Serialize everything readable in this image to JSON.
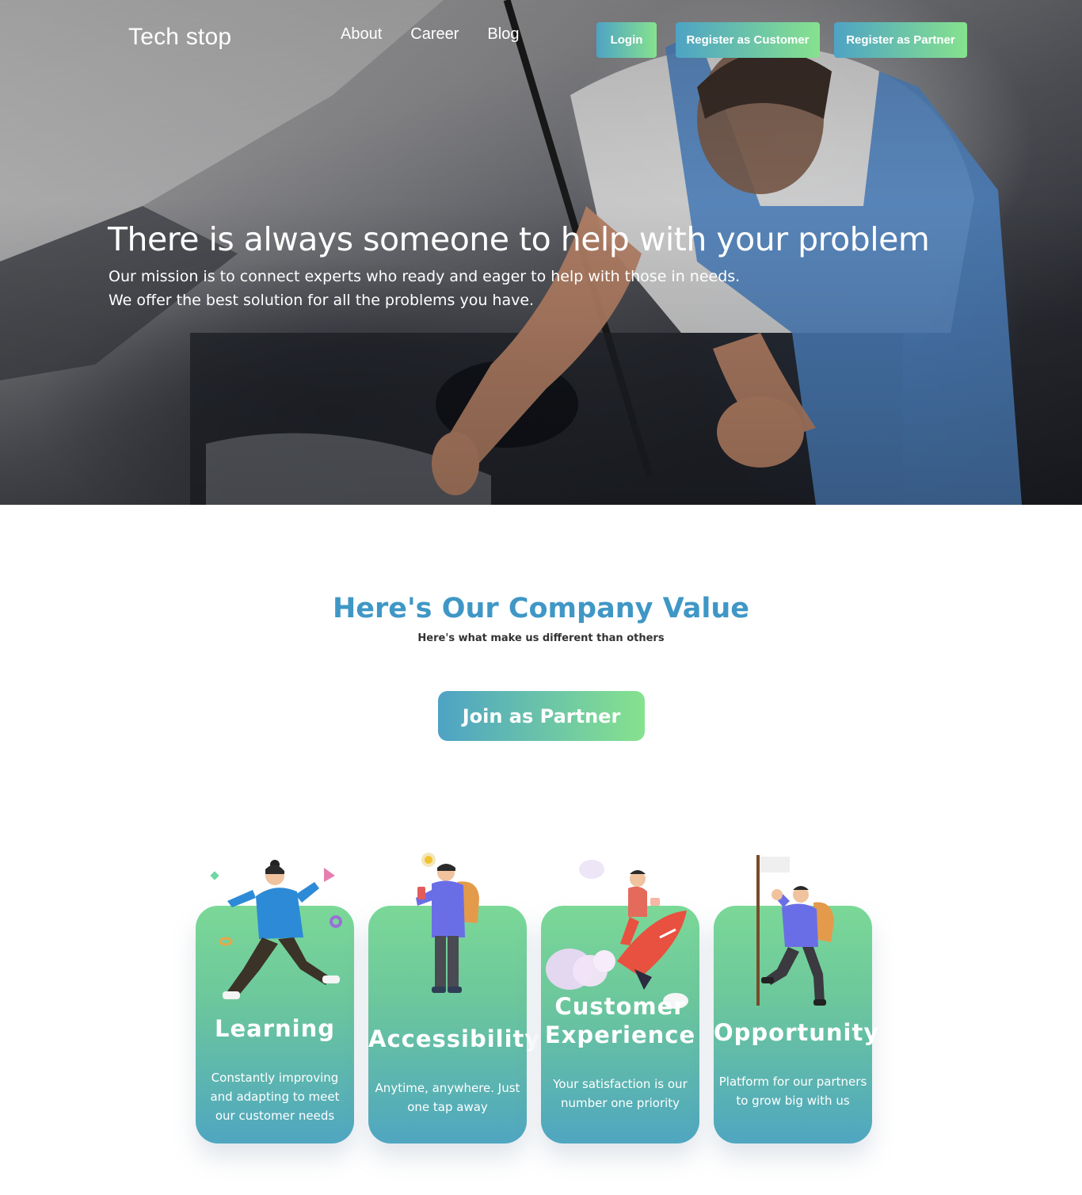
{
  "header": {
    "brand": "Tech stop",
    "nav": [
      "About",
      "Career",
      "Blog"
    ],
    "login_label": "Login",
    "register_customer_label": "Register as Customer",
    "register_partner_label": "Register as Partner"
  },
  "hero": {
    "title": "There is always someone to help with your problem",
    "subtitle_line1": "Our mission is to connect experts who ready and eager to help with those in needs.",
    "subtitle_line2": "We offer the best solution for all the problems you have."
  },
  "values": {
    "title": "Here's Our Company Value",
    "subtitle": "Here's what make us different than others",
    "join_label": "Join as Partner",
    "cards": [
      {
        "title": "Learning",
        "desc": "Constantly improving and adapting to meet our customer needs",
        "icon": "running-person-illustration"
      },
      {
        "title": "Accessibility",
        "desc": "Anytime, anywhere. Just one tap away",
        "icon": "person-with-phone-illustration"
      },
      {
        "title": "Customer Experience",
        "desc": "Your satisfaction is our number one priority",
        "icon": "person-on-rocket-illustration"
      },
      {
        "title": "Opportunity",
        "desc": "Platform for our partners to grow big with us",
        "icon": "person-with-flag-illustration"
      }
    ]
  },
  "colors": {
    "accent_blue": "#3f97c6",
    "gradient_start": "#4ea3c4",
    "gradient_end": "#86e28e"
  }
}
